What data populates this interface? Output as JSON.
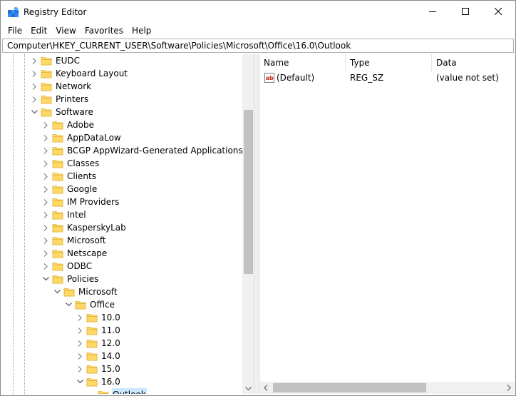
{
  "window": {
    "title": "Registry Editor",
    "app_icon": "registry-editor-icon"
  },
  "title_buttons": {
    "minimize": "minimize-icon",
    "maximize": "maximize-icon",
    "close": "close-icon"
  },
  "menu": {
    "items": [
      "File",
      "Edit",
      "View",
      "Favorites",
      "Help"
    ]
  },
  "address": {
    "path": "Computer\\HKEY_CURRENT_USER\\Software\\Policies\\Microsoft\\Office\\16.0\\Outlook"
  },
  "tree": {
    "items": [
      {
        "label": "EUDC",
        "level": 0,
        "expanded": false
      },
      {
        "label": "Keyboard Layout",
        "level": 0,
        "expanded": false
      },
      {
        "label": "Network",
        "level": 0,
        "expanded": false
      },
      {
        "label": "Printers",
        "level": 0,
        "expanded": false
      },
      {
        "label": "Software",
        "level": 0,
        "expanded": true
      },
      {
        "label": "Adobe",
        "level": 1,
        "expanded": false
      },
      {
        "label": "AppDataLow",
        "level": 1,
        "expanded": false
      },
      {
        "label": "BCGP AppWizard-Generated Applications",
        "level": 1,
        "expanded": false
      },
      {
        "label": "Classes",
        "level": 1,
        "expanded": false
      },
      {
        "label": "Clients",
        "level": 1,
        "expanded": false
      },
      {
        "label": "Google",
        "level": 1,
        "expanded": false
      },
      {
        "label": "IM Providers",
        "level": 1,
        "expanded": false
      },
      {
        "label": "Intel",
        "level": 1,
        "expanded": false
      },
      {
        "label": "KasperskyLab",
        "level": 1,
        "expanded": false
      },
      {
        "label": "Microsoft",
        "level": 1,
        "expanded": false
      },
      {
        "label": "Netscape",
        "level": 1,
        "expanded": false
      },
      {
        "label": "ODBC",
        "level": 1,
        "expanded": false
      },
      {
        "label": "Policies",
        "level": 1,
        "expanded": true
      },
      {
        "label": "Microsoft",
        "level": 2,
        "expanded": true
      },
      {
        "label": "Office",
        "level": 3,
        "expanded": true
      },
      {
        "label": "10.0",
        "level": 4,
        "expanded": false
      },
      {
        "label": "11.0",
        "level": 4,
        "expanded": false
      },
      {
        "label": "12.0",
        "level": 4,
        "expanded": false
      },
      {
        "label": "14.0",
        "level": 4,
        "expanded": false
      },
      {
        "label": "15.0",
        "level": 4,
        "expanded": false
      },
      {
        "label": "16.0",
        "level": 4,
        "expanded": true
      },
      {
        "label": "Outlook",
        "level": 5,
        "expanded": false,
        "selected": true,
        "leaf": true
      }
    ]
  },
  "values": {
    "columns": [
      "Name",
      "Type",
      "Data"
    ],
    "rows": [
      {
        "name": "(Default)",
        "type": "REG_SZ",
        "data": "(value not set)",
        "icon": "string-value-icon"
      }
    ]
  },
  "colors": {
    "selection": "#cce8ff",
    "folder_fill": "#ffd866",
    "folder_edge": "#e0b13a",
    "scroll_track": "#f0f0f0",
    "scroll_thumb": "#c1c1c1"
  }
}
